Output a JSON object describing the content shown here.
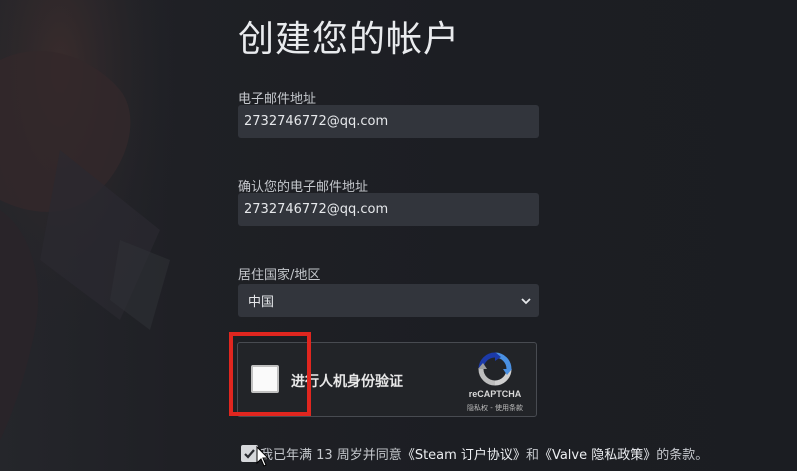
{
  "page": {
    "title": "创建您的帐户"
  },
  "form": {
    "email_label": "电子邮件地址",
    "email_value": "2732746772@qq.com",
    "confirm_email_label": "确认您的电子邮件地址",
    "confirm_email_value": "2732746772@qq.com",
    "country_label": "居住国家/地区",
    "country_value": "中国"
  },
  "captcha": {
    "label": "进行人机身份验证",
    "brand": "reCAPTCHA",
    "links": "隐私权 - 使用条款",
    "checked": false
  },
  "agreement": {
    "checked": true,
    "text_prefix": "我已年满 13 周岁并同意",
    "link_ssa": "《Steam 订户协议》",
    "text_and": "和",
    "link_privacy": "《Valve 隐私政策》",
    "text_suffix": "的条款。"
  },
  "colors": {
    "background": "#1d1f24",
    "input_background": "#32353c",
    "highlight": "#e0261f"
  }
}
